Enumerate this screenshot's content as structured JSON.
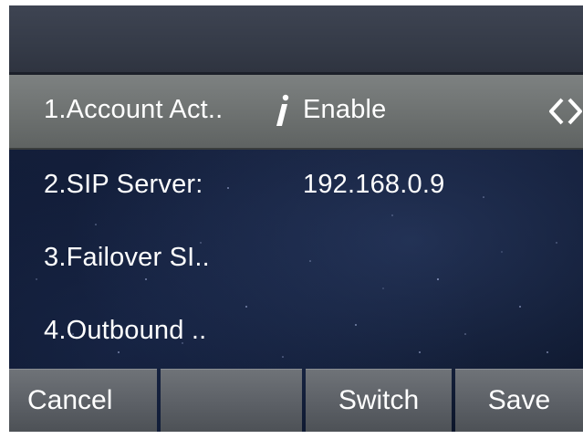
{
  "rows": [
    {
      "label": "1.Account Act..",
      "value": "Enable"
    },
    {
      "label": "2.SIP Server:",
      "value": "192.168.0.9"
    },
    {
      "label": "3.Failover SI..",
      "value": ""
    },
    {
      "label": "4.Outbound ..",
      "value": ""
    }
  ],
  "softkeys": {
    "key1": "Cancel",
    "key2": "",
    "key3": "Switch",
    "key4": "Save"
  },
  "icons": {
    "info": "info-icon",
    "left_right": "left-right-arrows-icon"
  },
  "colors": {
    "selected_row": "#6d7170",
    "background": "#101a33",
    "softkey": "#5c6066",
    "text": "#ffffff"
  }
}
